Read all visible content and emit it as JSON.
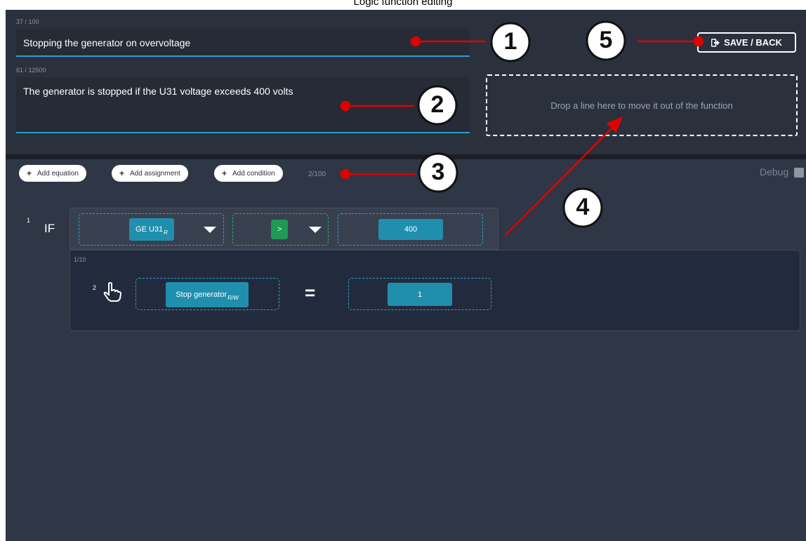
{
  "window": {
    "title": "Logic function editing"
  },
  "header": {
    "title_counter": "37 / 100",
    "title_value": "Stopping the generator on overvoltage",
    "desc_counter": "61 / 12500",
    "desc_value": "The generator is stopped if the U31 voltage exceeds 400 volts",
    "drop_zone_text": "Drop a line here to move it out of the function",
    "save_label": "SAVE / BACK"
  },
  "toolbar": {
    "add_equation": "Add equation",
    "add_assignment": "Add assignment",
    "add_condition": "Add condition",
    "line_count": "2/100",
    "debug_label": "Debug"
  },
  "lines": {
    "condition": {
      "number": "1",
      "keyword": "IF",
      "variable": "GE U31",
      "variable_access": "R",
      "operator": ">",
      "value": "400"
    },
    "block_counter": "1/10",
    "assignment": {
      "number": "2",
      "variable": "Stop generator",
      "variable_access": "R/W",
      "equals": "=",
      "value": "1"
    }
  },
  "annotations": {
    "callout_1": "1",
    "callout_2": "2",
    "callout_3": "3",
    "callout_4": "4",
    "callout_5": "5"
  },
  "colors": {
    "accent_blue": "#1f8fad",
    "accent_green": "#1f9955",
    "annotation_red": "#e00000",
    "background": "#2f3645"
  }
}
